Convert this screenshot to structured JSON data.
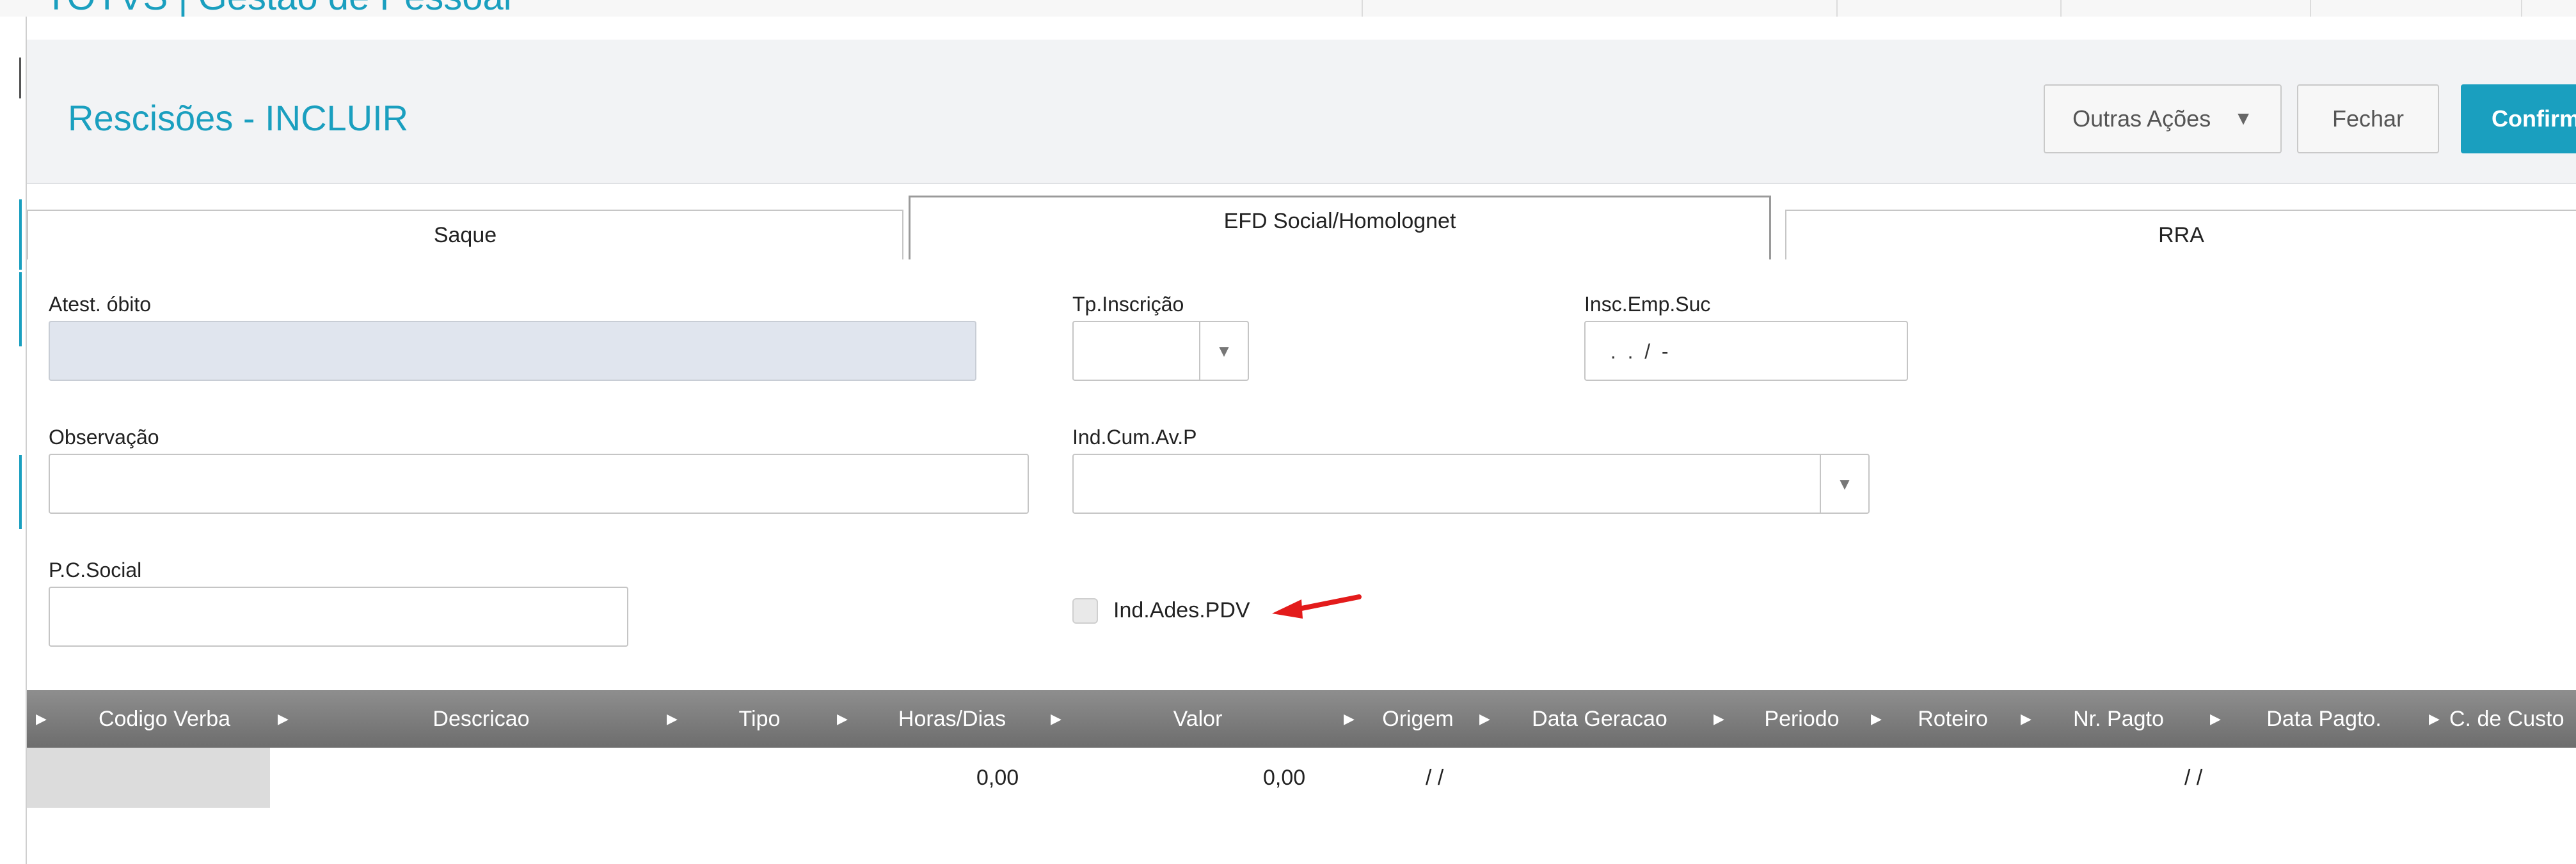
{
  "app": {
    "title": "TOTVS | Gestão de Pessoal"
  },
  "dialog": {
    "title": "Rescisões - INCLUIR",
    "buttons": {
      "other_actions": "Outras Ações",
      "close": "Fechar",
      "confirm": "Confirm"
    }
  },
  "tabs": [
    {
      "label": "Saque"
    },
    {
      "label": "EFD Social/Homolognet"
    },
    {
      "label": "RRA"
    }
  ],
  "form": {
    "atest_obito": {
      "label": "Atest. óbito",
      "value": ""
    },
    "tp_inscricao": {
      "label": "Tp.Inscrição",
      "value": ""
    },
    "insc_emp_suc": {
      "label": "Insc.Emp.Suc",
      "value": " .  .  /  -"
    },
    "observacao": {
      "label": "Observação",
      "value": ""
    },
    "ind_cum_av_p": {
      "label": "Ind.Cum.Av.P",
      "value": ""
    },
    "pc_social": {
      "label": "P.C.Social",
      "value": ""
    },
    "ind_ades_pdv": {
      "label": "Ind.Ades.PDV",
      "checked": false
    }
  },
  "grid": {
    "columns": [
      "Codigo Verba",
      "Descricao",
      "Tipo",
      "Horas/Dias",
      "Valor",
      "Origem",
      "Data Geracao",
      "Periodo",
      "Roteiro",
      "Nr. Pagto",
      "Data Pagto.",
      "C. de Custo"
    ],
    "rows": [
      {
        "codigo_verba": "",
        "descricao": "",
        "tipo": "",
        "horas_dias": "0,00",
        "valor": "0,00",
        "origem": "",
        "data_geracao": "/ /",
        "periodo": "",
        "roteiro": "",
        "nr_pagto": "",
        "data_pagto": "/ /",
        "c_de_custo": ""
      }
    ]
  },
  "icons": {
    "dropdown": "chevron-down-icon",
    "column_marker": "triangle-right-icon",
    "annotation": "red-arrow-icon"
  },
  "colors": {
    "accent": "#1a9fbf",
    "annotation": "#e31b1b",
    "grid_header": "#7d7d7d"
  }
}
